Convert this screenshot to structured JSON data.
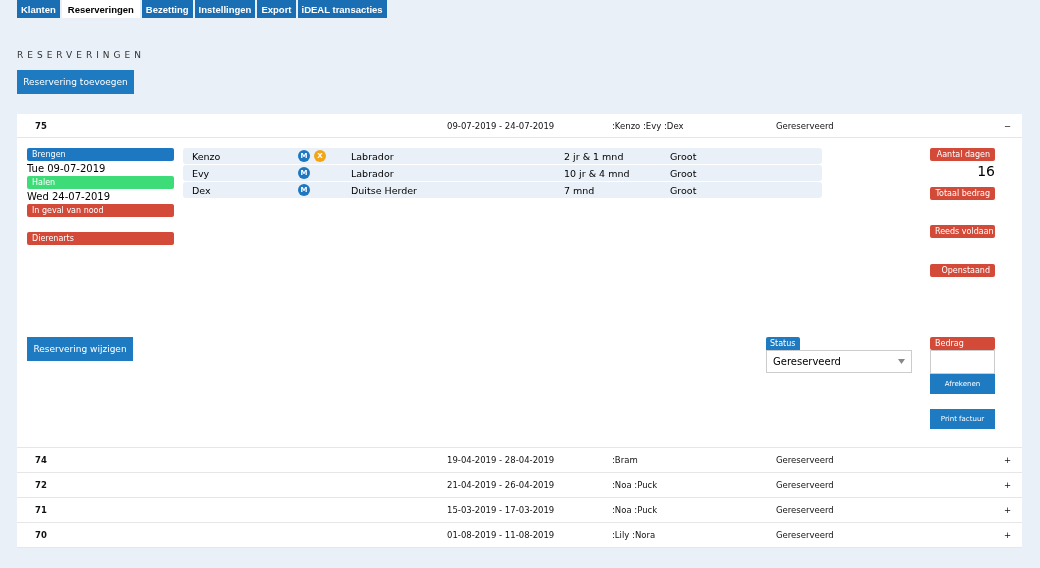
{
  "tabs": [
    {
      "label": "Klanten",
      "selected": false
    },
    {
      "label": "Reserveringen",
      "selected": true
    },
    {
      "label": "Bezetting",
      "selected": false
    },
    {
      "label": "Instellingen",
      "selected": false
    },
    {
      "label": "Export",
      "selected": false
    },
    {
      "label": "iDEAL transacties",
      "selected": false
    }
  ],
  "heading": "RESERVERINGEN",
  "add_button": "Reservering toevoegen",
  "reservations": [
    {
      "id": "75",
      "dates": "09-07-2019 - 24-07-2019",
      "pets": ":Kenzo :Evy :Dex",
      "status": "Gereserveerd",
      "toggle": "−",
      "expanded": true,
      "detail": {
        "schedule": [
          {
            "label": "Brengen",
            "color": "#1d78c1",
            "value": "Tue 09-07-2019"
          },
          {
            "label": "Halen",
            "color": "#3ddc78",
            "value": "Wed 24-07-2019"
          },
          {
            "label": "In geval van nood",
            "color": "#d34a39"
          },
          {
            "label": "Dierenarts",
            "color": "#d34a39"
          }
        ],
        "animals": [
          {
            "name": "Kenzo",
            "badges": [
              {
                "letter": "M",
                "color": "#1d78c1"
              },
              {
                "letter": "X",
                "color": "#f2a516"
              }
            ],
            "breed": "Labrador",
            "age": "2 jr & 1 mnd",
            "size": "Groot"
          },
          {
            "name": "Evy",
            "badges": [
              {
                "letter": "M",
                "color": "#1d78c1"
              }
            ],
            "breed": "Labrador",
            "age": "10 jr & 4 mnd",
            "size": "Groot"
          },
          {
            "name": "Dex",
            "badges": [
              {
                "letter": "M",
                "color": "#1d78c1"
              }
            ],
            "breed": "Duitse Herder",
            "age": "7 mnd",
            "size": "Groot"
          }
        ],
        "totals": [
          {
            "label": "Aantal dagen",
            "value": "16"
          },
          {
            "label": "Totaal bedrag"
          },
          {
            "label": "Reeds voldaan"
          },
          {
            "label": "Openstaand"
          }
        ],
        "edit_button": "Reservering wijzigen",
        "status_field": {
          "label": "Status",
          "value": "Gereserveerd"
        },
        "amount_field": {
          "label": "Bedrag"
        },
        "pay_button": "Afrekenen",
        "invoice_button": "Print factuur"
      }
    },
    {
      "id": "74",
      "dates": "19-04-2019 - 28-04-2019",
      "pets": ":Bram",
      "status": "Gereserveerd",
      "toggle": "+",
      "expanded": false
    },
    {
      "id": "72",
      "dates": "21-04-2019 - 26-04-2019",
      "pets": ":Noa :Puck",
      "status": "Gereserveerd",
      "toggle": "+",
      "expanded": false
    },
    {
      "id": "71",
      "dates": "15-03-2019 - 17-03-2019",
      "pets": ":Noa :Puck",
      "status": "Gereserveerd",
      "toggle": "+",
      "expanded": false
    },
    {
      "id": "70",
      "dates": "01-08-2019 - 11-08-2019",
      "pets": ":Lily :Nora",
      "status": "Gereserveerd",
      "toggle": "+",
      "expanded": false
    }
  ]
}
